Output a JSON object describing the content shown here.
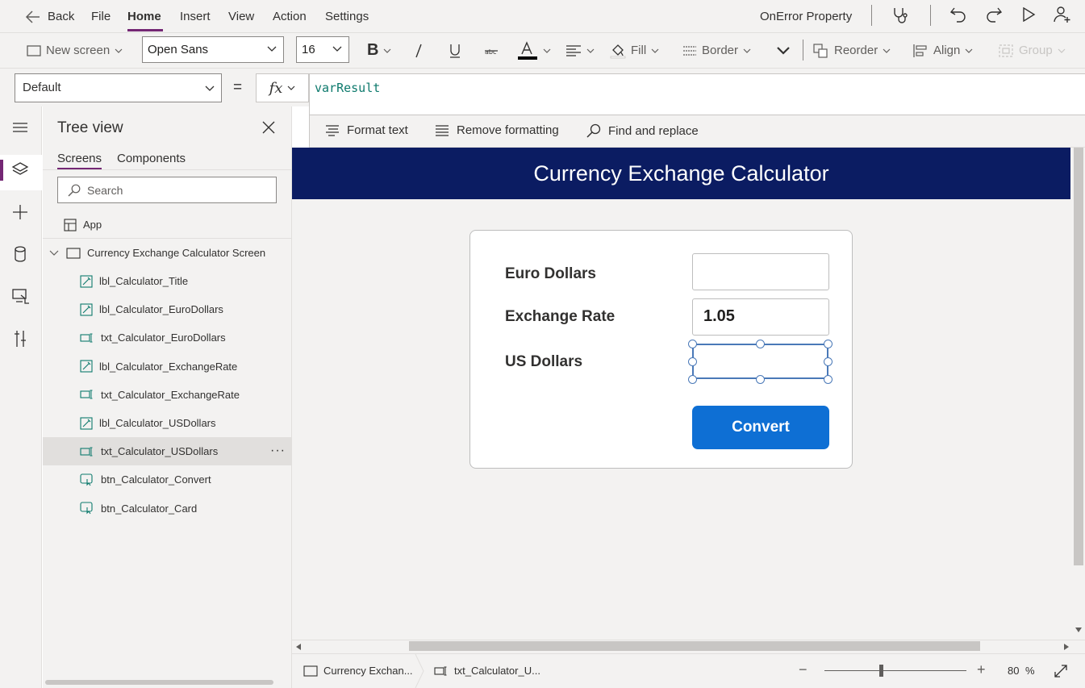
{
  "menubar": {
    "back_label": "Back",
    "items": [
      "File",
      "Home",
      "Insert",
      "View",
      "Action",
      "Settings"
    ],
    "active_item": "Home",
    "property_title": "OnError Property"
  },
  "ribbon": {
    "new_screen": "New screen",
    "font_name": "Open Sans",
    "font_size": "16",
    "fill": "Fill",
    "border": "Border",
    "reorder": "Reorder",
    "align": "Align",
    "group": "Group"
  },
  "formula": {
    "property": "Default",
    "equals": "=",
    "fx": "fx",
    "value": "varResult",
    "format_text": "Format text",
    "remove_formatting": "Remove formatting",
    "find_replace": "Find and replace"
  },
  "tree": {
    "title": "Tree view",
    "tabs": [
      "Screens",
      "Components"
    ],
    "search_placeholder": "Search",
    "app": "App",
    "screen": "Currency Exchange Calculator Screen",
    "items": [
      {
        "label": "lbl_Calculator_Title",
        "icon": "label-icon"
      },
      {
        "label": "lbl_Calculator_EuroDollars",
        "icon": "label-icon"
      },
      {
        "label": "txt_Calculator_EuroDollars",
        "icon": "text-input-icon"
      },
      {
        "label": "lbl_Calculator_ExchangeRate",
        "icon": "label-icon"
      },
      {
        "label": "txt_Calculator_ExchangeRate",
        "icon": "text-input-icon"
      },
      {
        "label": "lbl_Calculator_USDollars",
        "icon": "label-icon"
      },
      {
        "label": "txt_Calculator_USDollars",
        "icon": "text-input-icon",
        "selected": true
      },
      {
        "label": "btn_Calculator_Convert",
        "icon": "button-icon"
      },
      {
        "label": "btn_Calculator_Card",
        "icon": "button-icon"
      }
    ],
    "more": "···"
  },
  "app": {
    "title": "Currency Exchange Calculator",
    "euro_label": "Euro Dollars",
    "euro_value": "",
    "rate_label": "Exchange Rate",
    "rate_value": "1.05",
    "usd_label": "US Dollars",
    "usd_value": "",
    "convert_label": "Convert",
    "colors": {
      "header": "#0b1c62",
      "button": "#0e6fd4",
      "accent": "#742774"
    }
  },
  "status": {
    "screen_crumb": "Currency Exchan...",
    "control_crumb": "txt_Calculator_U...",
    "zoom_minus": "−",
    "zoom_plus": "+",
    "zoom_value": "80",
    "zoom_unit": "%",
    "zoom_level": 0.8
  }
}
